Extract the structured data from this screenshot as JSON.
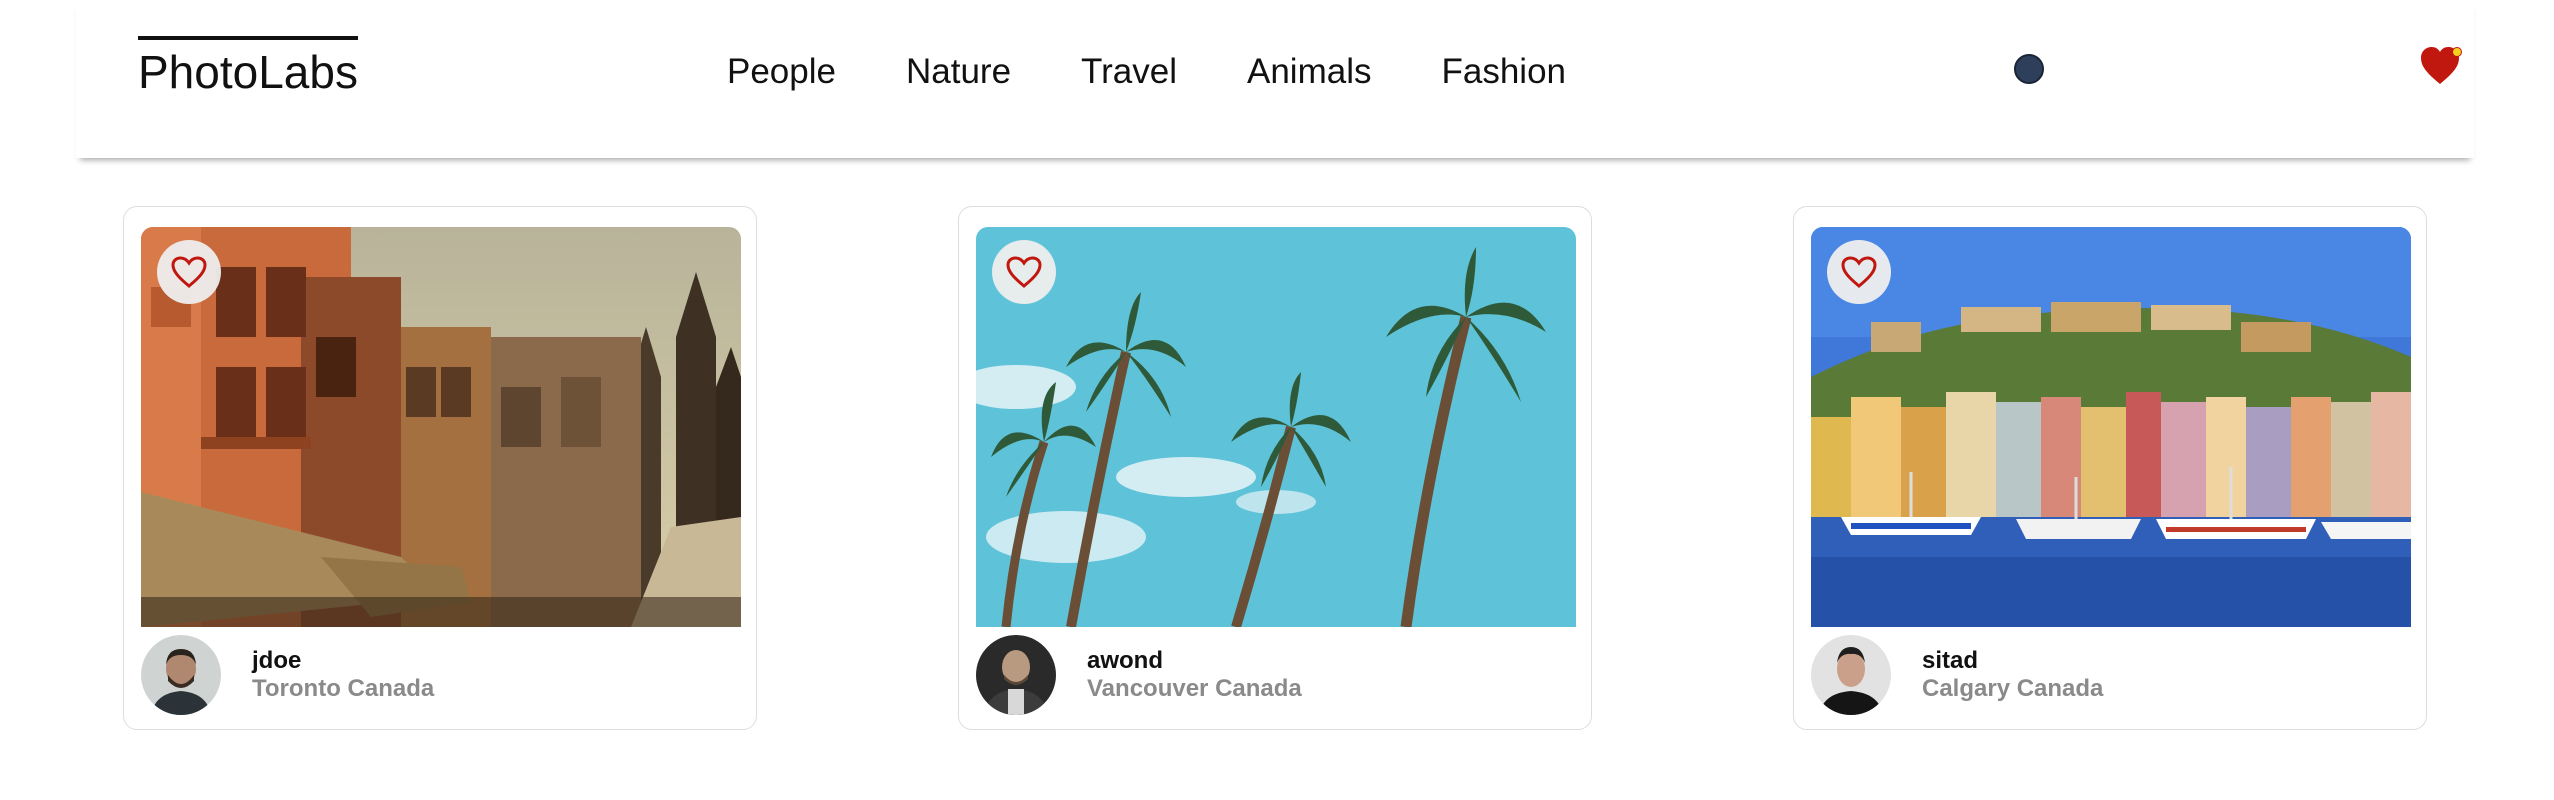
{
  "nav": {
    "logo": "PhotoLabs",
    "topics": [
      "People",
      "Nature",
      "Travel",
      "Animals",
      "Fashion"
    ],
    "favorite_badge_icon": "heart-with-notification-icon",
    "status_dot_color": "#2e3f5b"
  },
  "colors": {
    "heart": "#c0170e",
    "notification": "#f2d21e",
    "location_text": "#8a8a8a"
  },
  "photos": [
    {
      "username": "jdoe",
      "location": "Toronto Canada",
      "favorite_icon": "heart-outline-icon"
    },
    {
      "username": "awond",
      "location": "Vancouver Canada",
      "favorite_icon": "heart-outline-icon"
    },
    {
      "username": "sitad",
      "location": "Calgary Canada",
      "favorite_icon": "heart-outline-icon"
    }
  ]
}
